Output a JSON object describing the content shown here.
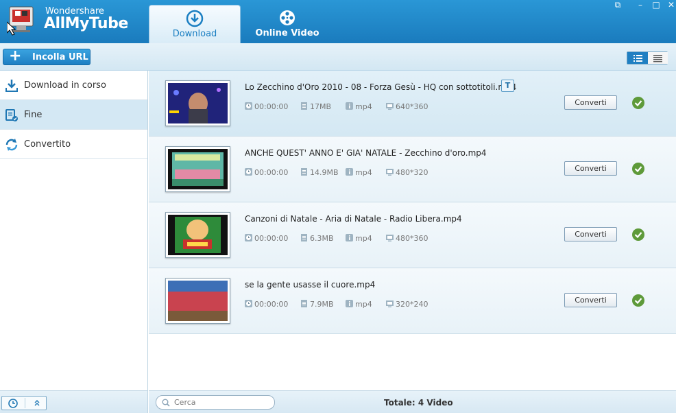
{
  "app": {
    "brand_small": "Wondershare",
    "brand_big": "AllMyTube",
    "accent": "#1a7bbd"
  },
  "tabs": [
    {
      "label": "Download",
      "icon": "download-circle-icon",
      "active": true
    },
    {
      "label": "Online Video",
      "icon": "film-reel-icon",
      "active": false
    }
  ],
  "toolbar": {
    "paste_label": "Incolla URL"
  },
  "sidebar": {
    "items": [
      {
        "label": "Download in corso",
        "icon": "download-arrow-icon",
        "active": false
      },
      {
        "label": "Fine",
        "icon": "finished-icon",
        "active": true
      },
      {
        "label": "Convertito",
        "icon": "converted-icon",
        "active": false
      }
    ]
  },
  "videos": [
    {
      "title": "Lo Zecchino d'Oro 2010 - 08 - Forza Gesù - HQ con sottotitoli.mp4",
      "badge": "T",
      "duration": "00:00:00",
      "size": "17MB",
      "format": "mp4",
      "resolution": "640*360",
      "convert_label": "Converti",
      "status": "done"
    },
    {
      "title": "ANCHE QUEST' ANNO E' GIA' NATALE  -  Zecchino d'oro.mp4",
      "badge": "",
      "duration": "00:00:00",
      "size": "14.9MB",
      "format": "mp4",
      "resolution": "480*320",
      "convert_label": "Converti",
      "status": "done"
    },
    {
      "title": "Canzoni di Natale - Aria di Natale - Radio Libera.mp4",
      "badge": "",
      "duration": "00:00:00",
      "size": "6.3MB",
      "format": "mp4",
      "resolution": "480*360",
      "convert_label": "Converti",
      "status": "done"
    },
    {
      "title": "se la gente usasse il cuore.mp4",
      "badge": "",
      "duration": "00:00:00",
      "size": "7.9MB",
      "format": "mp4",
      "resolution": "320*240",
      "convert_label": "Converti",
      "status": "done"
    }
  ],
  "footer": {
    "search_placeholder": "Cerca",
    "total": "Totale: 4 Video"
  }
}
